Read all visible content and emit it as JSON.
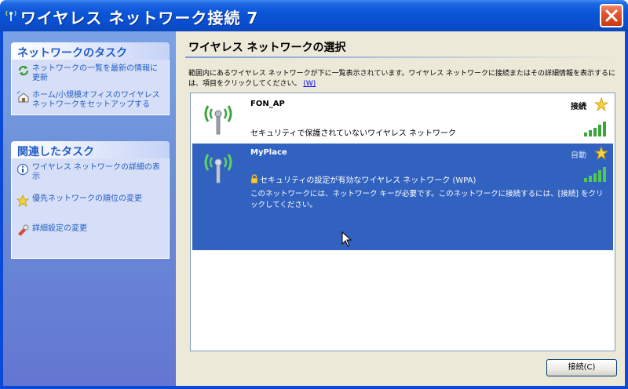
{
  "window": {
    "title": "ワイヤレス ネットワーク接続 7",
    "colors": {
      "titlebar": "#0a55d8",
      "close": "#e0552f",
      "selection": "#3162c0"
    }
  },
  "sidebar": {
    "network_tasks": {
      "header": "ネットワークのタスク",
      "items": [
        {
          "label": "ネットワークの一覧を最新の情報に更新",
          "icon": "refresh-icon"
        },
        {
          "label": "ホーム/小規模オフィスのワイヤレス ネットワークをセットアップする",
          "icon": "home-network-icon"
        }
      ]
    },
    "related_tasks": {
      "header": "関連したタスク",
      "items": [
        {
          "label": "ワイヤレス ネットワークの詳細の表示",
          "icon": "info-icon"
        },
        {
          "label": "優先ネットワークの順位の変更",
          "icon": "star-icon"
        },
        {
          "label": "詳細設定の変更",
          "icon": "settings-icon"
        }
      ]
    }
  },
  "main": {
    "title": "ワイヤレス ネットワークの選択",
    "description": "範囲内にあるワイヤレス ネットワークが下に一覧表示されています。ワイヤレス ネットワークに接続またはその詳細情報を表示するには、項目をクリックしてください。",
    "description_link": "(W)",
    "networks": [
      {
        "name": "FON_AP",
        "status": "接続",
        "security": "セキュリティで保護されていないワイヤレス ネットワーク",
        "signal": 5
      },
      {
        "name": "MyPlace",
        "status": "自動",
        "security": "セキュリティの設定が有効なワイヤレス ネットワーク (WPA)",
        "note": "このネットワークには、ネットワーク キーが必要です。このネットワークに接続するには、[接続] をクリックしてください。",
        "signal": 5
      }
    ],
    "connect_button": "接続(C)"
  }
}
